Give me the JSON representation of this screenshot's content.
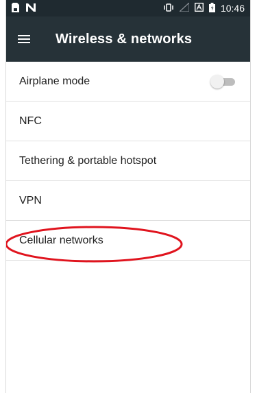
{
  "status_bar": {
    "time": "10:46",
    "icons": [
      "sim-card-icon",
      "n-notification-icon",
      "vibrate-icon",
      "signal-icon",
      "a-notification-icon",
      "battery-icon"
    ]
  },
  "app_bar": {
    "title": "Wireless & networks",
    "menu_icon": "hamburger-menu-icon"
  },
  "settings": {
    "items": [
      {
        "label": "Airplane mode",
        "toggle": "off"
      },
      {
        "label": "NFC"
      },
      {
        "label": "Tethering & portable hotspot"
      },
      {
        "label": "VPN"
      },
      {
        "label": "Cellular networks",
        "highlighted": true
      }
    ]
  },
  "colors": {
    "status_bar": "#1f2a30",
    "app_bar": "#263238",
    "annotation": "#e0141e"
  }
}
